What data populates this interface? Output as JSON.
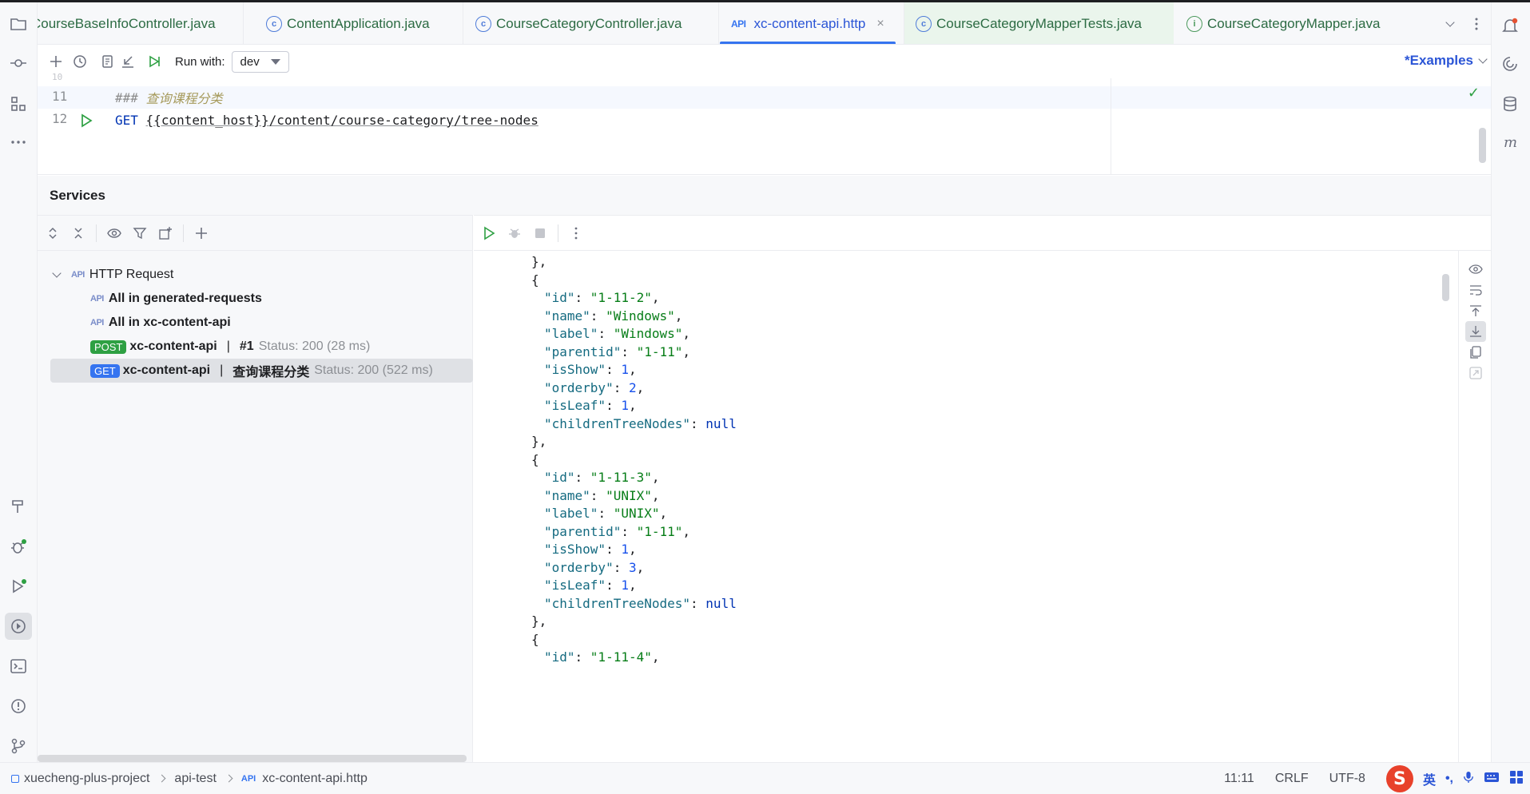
{
  "tabs": [
    {
      "label": "CourseBaseInfoController.java",
      "icon": "class-icon"
    },
    {
      "label": "ContentApplication.java",
      "icon": "class-icon"
    },
    {
      "label": "CourseCategoryController.java",
      "icon": "class-icon"
    },
    {
      "label": "xc-content-api.http",
      "icon": "api-icon",
      "active": true,
      "close": "×"
    },
    {
      "label": "CourseCategoryMapperTests.java",
      "icon": "class-icon"
    },
    {
      "label": "CourseCategoryMapper.java",
      "icon": "interface-icon"
    }
  ],
  "toolbar": {
    "run_with_label": "Run with:",
    "env_value": "dev",
    "examples_label": "*Examples"
  },
  "editor": {
    "lines": [
      {
        "number": "11",
        "comment_prefix": "###",
        "comment_text": "查询课程分类"
      },
      {
        "number": "12",
        "method": "GET",
        "url_var": "{{content_host}}",
        "url_path": "/content/course-category/tree-nodes"
      }
    ]
  },
  "services": {
    "title": "Services",
    "tree": {
      "root_label": "HTTP Request",
      "items": [
        {
          "label": "All in generated-requests"
        },
        {
          "label": "All in xc-content-api"
        },
        {
          "badge": "POST",
          "name": "xc-content-api",
          "separator": "|",
          "request": "#1",
          "status": "Status: 200 (28 ms)"
        },
        {
          "badge": "GET",
          "name": "xc-content-api",
          "separator": "|",
          "request": "查询课程分类",
          "status": "Status: 200 (522 ms)",
          "selected": true
        }
      ]
    }
  },
  "response_json": [
    {
      "indent": 0,
      "text": "},"
    },
    {
      "indent": 0,
      "text": "{"
    },
    {
      "indent": 1,
      "key": "\"id\"",
      "value": "\"1-11-2\"",
      "type": "str",
      "comma": true
    },
    {
      "indent": 1,
      "key": "\"name\"",
      "value": "\"Windows\"",
      "type": "str",
      "comma": true
    },
    {
      "indent": 1,
      "key": "\"label\"",
      "value": "\"Windows\"",
      "type": "str",
      "comma": true
    },
    {
      "indent": 1,
      "key": "\"parentid\"",
      "value": "\"1-11\"",
      "type": "str",
      "comma": true
    },
    {
      "indent": 1,
      "key": "\"isShow\"",
      "value": "1",
      "type": "num",
      "comma": true
    },
    {
      "indent": 1,
      "key": "\"orderby\"",
      "value": "2",
      "type": "num",
      "comma": true
    },
    {
      "indent": 1,
      "key": "\"isLeaf\"",
      "value": "1",
      "type": "num",
      "comma": true
    },
    {
      "indent": 1,
      "key": "\"childrenTreeNodes\"",
      "value": "null",
      "type": "null",
      "comma": false
    },
    {
      "indent": 0,
      "text": "},"
    },
    {
      "indent": 0,
      "text": "{"
    },
    {
      "indent": 1,
      "key": "\"id\"",
      "value": "\"1-11-3\"",
      "type": "str",
      "comma": true
    },
    {
      "indent": 1,
      "key": "\"name\"",
      "value": "\"UNIX\"",
      "type": "str",
      "comma": true
    },
    {
      "indent": 1,
      "key": "\"label\"",
      "value": "\"UNIX\"",
      "type": "str",
      "comma": true
    },
    {
      "indent": 1,
      "key": "\"parentid\"",
      "value": "\"1-11\"",
      "type": "str",
      "comma": true
    },
    {
      "indent": 1,
      "key": "\"isShow\"",
      "value": "1",
      "type": "num",
      "comma": true
    },
    {
      "indent": 1,
      "key": "\"orderby\"",
      "value": "3",
      "type": "num",
      "comma": true
    },
    {
      "indent": 1,
      "key": "\"isLeaf\"",
      "value": "1",
      "type": "num",
      "comma": true
    },
    {
      "indent": 1,
      "key": "\"childrenTreeNodes\"",
      "value": "null",
      "type": "null",
      "comma": false
    },
    {
      "indent": 0,
      "text": "},"
    },
    {
      "indent": 0,
      "text": "{"
    },
    {
      "indent": 1,
      "key": "\"id\"",
      "value": "\"1-11-4\"",
      "type": "str",
      "comma": true
    }
  ],
  "statusbar": {
    "breadcrumbs": [
      "xuecheng-plus-project",
      "api-test",
      "xc-content-api.http"
    ],
    "position": "11:11",
    "line_ending": "CRLF",
    "encoding": "UTF-8",
    "ime_lang": "英",
    "ime_punct": "•,"
  },
  "colors": {
    "accent": "#3574f0",
    "post_badge": "#2ea043",
    "get_badge": "#3574f0"
  }
}
